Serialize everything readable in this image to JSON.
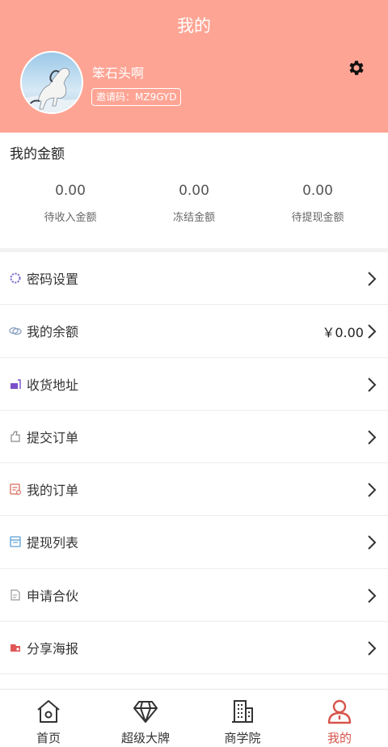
{
  "header": {
    "title": "我的",
    "user_name": "笨石头啊",
    "invite_code": "邀请码：MZ9GYD",
    "settings_icon": "gear-icon",
    "avatar_icon": "horse-avatar",
    "background_color": "#fea494"
  },
  "amounts": {
    "title": "我的金额",
    "items": [
      {
        "value": "0.00",
        "label": "待收入金额"
      },
      {
        "value": "0.00",
        "label": "冻结金额"
      },
      {
        "value": "0.00",
        "label": "待提现金额"
      }
    ]
  },
  "menu": {
    "items": [
      {
        "label": "密码设置",
        "icon": "password-settings-icon",
        "value": ""
      },
      {
        "label": "我的余额",
        "icon": "balance-icon",
        "value": "￥0.00"
      },
      {
        "label": "收货地址",
        "icon": "address-icon",
        "value": ""
      },
      {
        "label": "提交订单",
        "icon": "submit-order-icon",
        "value": ""
      },
      {
        "label": "我的订单",
        "icon": "my-orders-icon",
        "value": ""
      },
      {
        "label": "提现列表",
        "icon": "withdraw-list-icon",
        "value": ""
      },
      {
        "label": "申请合伙",
        "icon": "partnership-icon",
        "value": ""
      },
      {
        "label": "分享海报",
        "icon": "share-poster-icon",
        "value": ""
      }
    ]
  },
  "tabbar": {
    "active_index": 3,
    "active_color": "#d7544b",
    "tabs": [
      {
        "label": "首页",
        "icon": "home-icon"
      },
      {
        "label": "超级大牌",
        "icon": "diamond-icon"
      },
      {
        "label": "商学院",
        "icon": "building-icon"
      },
      {
        "label": "我的",
        "icon": "user-icon"
      }
    ]
  }
}
